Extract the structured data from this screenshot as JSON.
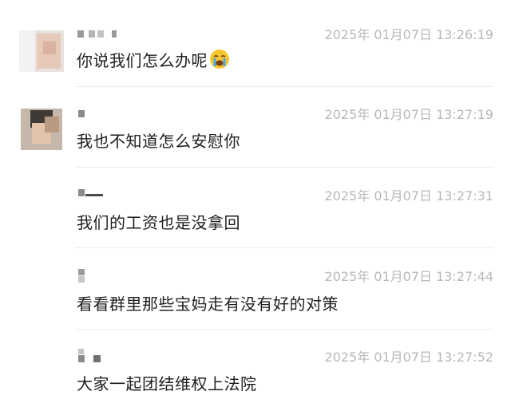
{
  "chat_history": {
    "messages": [
      {
        "time": "2025年 01月07日 13:26:19",
        "text": "你说我们怎么办呢",
        "emoji": "crying-face-emoji"
      },
      {
        "time": "2025年 01月07日 13:27:19",
        "text": "我也不知道怎么安慰你"
      },
      {
        "time": "2025年 01月07日 13:27:31",
        "text": "我们的工资也是没拿回"
      },
      {
        "time": "2025年 01月07日 13:27:44",
        "text": "看看群里那些宝妈走有没有好的对策"
      },
      {
        "time": "2025年 01月07日 13:27:52",
        "text": "大家一起团结维权上法院"
      }
    ]
  }
}
